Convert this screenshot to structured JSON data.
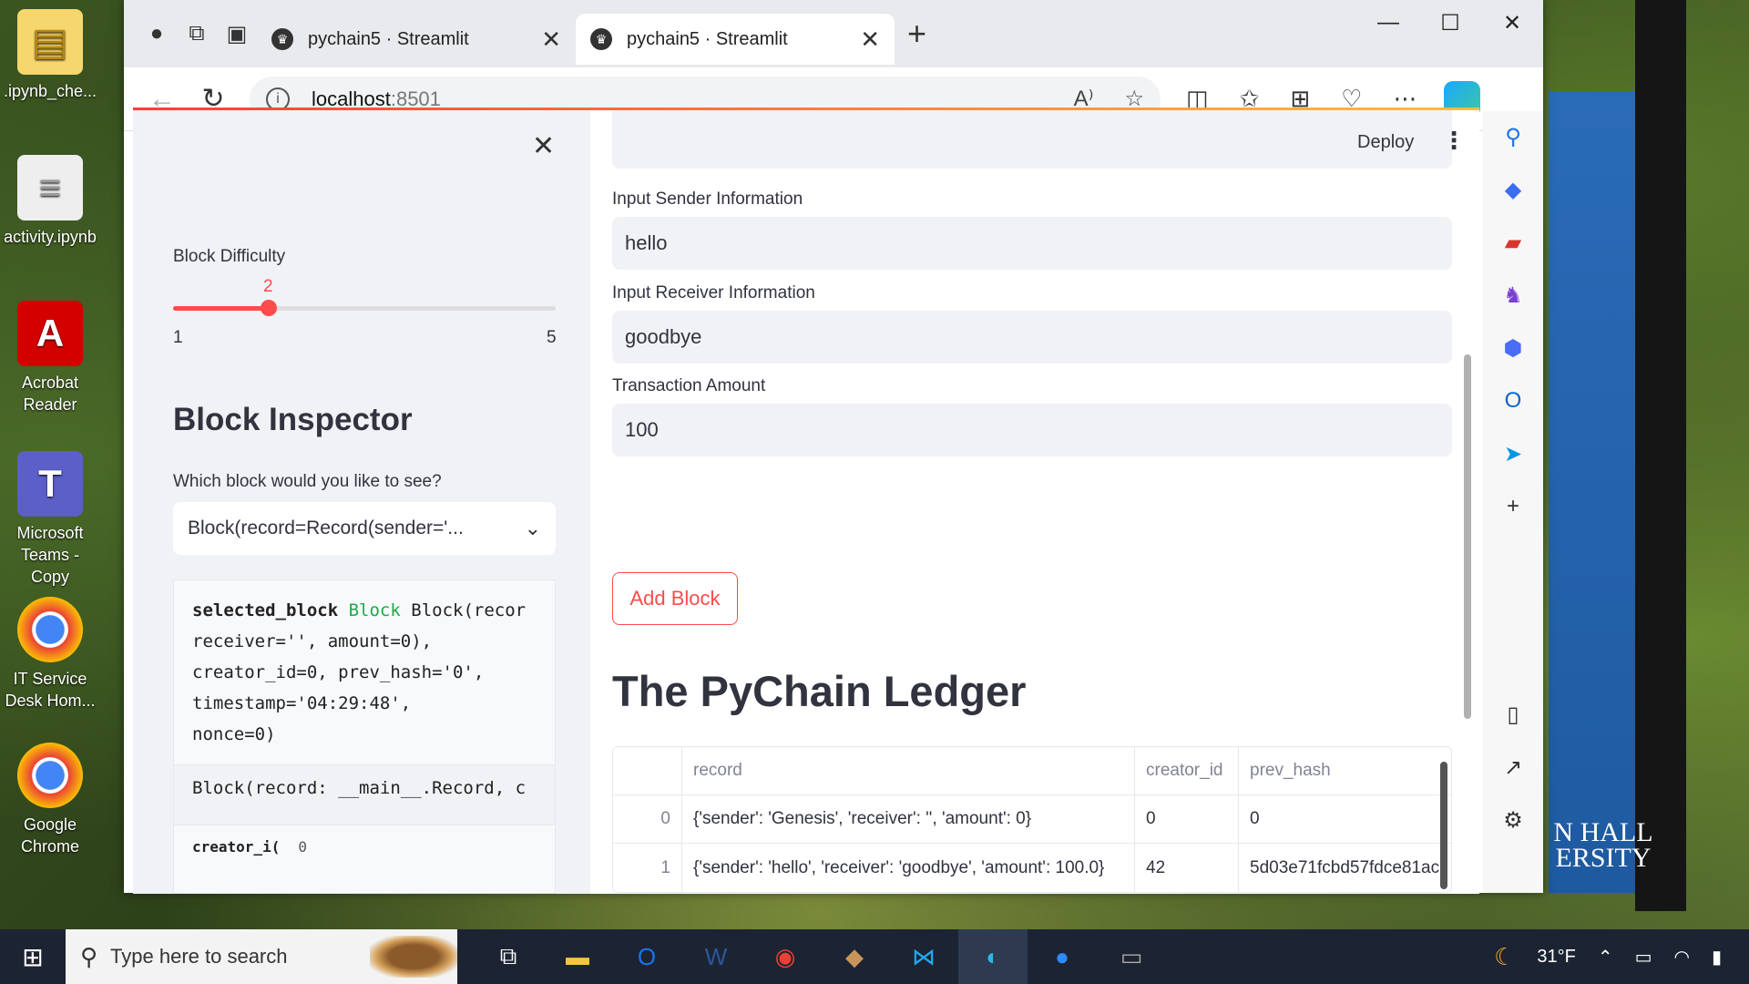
{
  "desktop": {
    "icons": [
      {
        "label": ".ipynb_che...",
        "glyph": "📁",
        "bg": "#f5d76e"
      },
      {
        "label": "activity.ipynb",
        "glyph": "≡",
        "bg": "#e8e8e8"
      },
      {
        "label": "Acrobat Reader",
        "glyph": "A",
        "bg": "#d40000"
      },
      {
        "label": "Microsoft Teams - Copy",
        "glyph": "T",
        "bg": "#5b5fc7"
      },
      {
        "label": "IT Service Desk Hom...",
        "glyph": "◉",
        "bg": "transparent"
      },
      {
        "label": "Google Chrome",
        "glyph": "◉",
        "bg": "transparent"
      }
    ],
    "banner_text": "N HALL ERSITY"
  },
  "browser": {
    "tabs": [
      {
        "title": "pychain5 · Streamlit",
        "active": false
      },
      {
        "title": "pychain5 · Streamlit",
        "active": true
      }
    ],
    "url_host": "localhost",
    "url_port": ":8501"
  },
  "sidebar": {
    "difficulty_label": "Block Difficulty",
    "difficulty_value": "2",
    "difficulty_min": "1",
    "difficulty_max": "5",
    "difficulty_fraction": 0.25,
    "inspector_title": "Block Inspector",
    "select_label": "Which block would you like to see?",
    "select_value": "Block(record=Record(sender='...",
    "code_var": "selected_block",
    "code_type": "Block",
    "code_lines": [
      " Block(recor",
      "receiver='', amount=0),",
      "creator_id=0, prev_hash='0',",
      "timestamp='04:29:48',",
      "nonce=0)"
    ],
    "repr_line": "Block(record: __main__.Record, c",
    "attr_name": "creator_i(",
    "attr_value": "0"
  },
  "main": {
    "deploy_label": "Deploy",
    "sender_label": "Input Sender Information",
    "sender_value": "hello",
    "receiver_label": "Input Receiver Information",
    "receiver_value": "goodbye",
    "amount_label": "Transaction Amount",
    "amount_value": "100",
    "add_button": "Add Block",
    "ledger_title": "The PyChain Ledger",
    "table": {
      "headers": [
        "",
        "record",
        "creator_id",
        "prev_hash"
      ],
      "rows": [
        [
          "0",
          "{'sender': 'Genesis', 'receiver': '', 'amount': 0}",
          "0",
          "0"
        ],
        [
          "1",
          "{'sender': 'hello', 'receiver': 'goodbye', 'amount': 100.0}",
          "42",
          "5d03e71fcbd57fdce81ac"
        ]
      ]
    }
  },
  "taskbar": {
    "search_placeholder": "Type here to search",
    "weather": "31°F"
  },
  "colors": {
    "accent": "#ff4b4b",
    "sidebar_bg": "#f0f2f6",
    "text": "#31333f"
  }
}
